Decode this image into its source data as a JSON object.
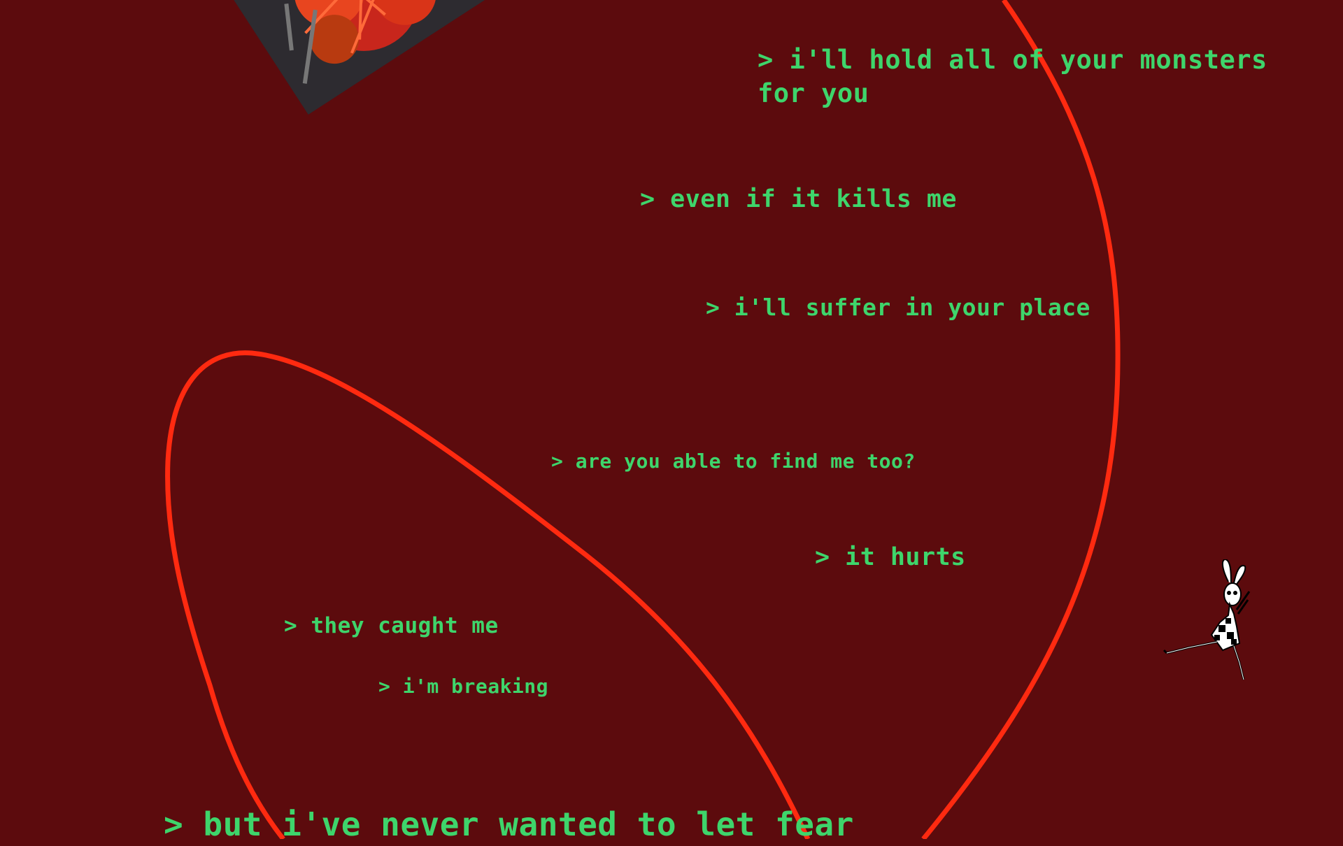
{
  "theme": {
    "background": "#5c0b0d",
    "text_color": "#3ed56b",
    "curve_color": "#ff2a10"
  },
  "decor": {
    "image_1": "flower-photo",
    "image_2": "checkered-rabbit-illustration"
  },
  "lines": [
    "> i'll hold all of your monsters for you",
    "> even if it kills me",
    "> i'll suffer in your place",
    "> are you able to find me too?",
    "> it hurts",
    "> they caught me",
    "> i'm breaking",
    "> but i've never wanted to let fear"
  ]
}
